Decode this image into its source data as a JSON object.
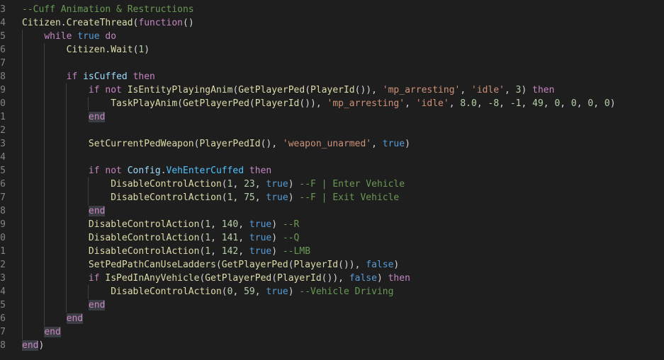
{
  "editor": {
    "language": "lua",
    "lines": [
      {
        "no": "3",
        "segs": [
          {
            "t": "--Cuff Animation & Restructions",
            "c": "c"
          }
        ]
      },
      {
        "no": "4",
        "segs": [
          {
            "t": "Citizen",
            "c": "fn"
          },
          {
            "t": ".",
            "c": "pl"
          },
          {
            "t": "CreateThread",
            "c": "fn"
          },
          {
            "t": "(",
            "c": "pl"
          },
          {
            "t": "function",
            "c": "kw"
          },
          {
            "t": "()",
            "c": "pl"
          }
        ]
      },
      {
        "no": "5",
        "segs": [
          {
            "t": "    ",
            "c": "pl"
          },
          {
            "t": "while",
            "c": "kw"
          },
          {
            "t": " ",
            "c": "pl"
          },
          {
            "t": "true",
            "c": "bl"
          },
          {
            "t": " ",
            "c": "pl"
          },
          {
            "t": "do",
            "c": "kw"
          }
        ]
      },
      {
        "no": "6",
        "segs": [
          {
            "t": "        ",
            "c": "pl"
          },
          {
            "t": "Citizen",
            "c": "fn"
          },
          {
            "t": ".",
            "c": "pl"
          },
          {
            "t": "Wait",
            "c": "fn"
          },
          {
            "t": "(",
            "c": "pl"
          },
          {
            "t": "1",
            "c": "nu"
          },
          {
            "t": ")",
            "c": "pl"
          }
        ]
      },
      {
        "no": "7",
        "segs": []
      },
      {
        "no": "8",
        "segs": [
          {
            "t": "        ",
            "c": "pl"
          },
          {
            "t": "if",
            "c": "kw"
          },
          {
            "t": " ",
            "c": "pl"
          },
          {
            "t": "isCuffed",
            "c": "vr"
          },
          {
            "t": " ",
            "c": "pl"
          },
          {
            "t": "then",
            "c": "kw"
          }
        ]
      },
      {
        "no": "9",
        "segs": [
          {
            "t": "            ",
            "c": "pl"
          },
          {
            "t": "if",
            "c": "kw"
          },
          {
            "t": " ",
            "c": "pl"
          },
          {
            "t": "not",
            "c": "kw"
          },
          {
            "t": " ",
            "c": "pl"
          },
          {
            "t": "IsEntityPlayingAnim",
            "c": "fn"
          },
          {
            "t": "(",
            "c": "pl"
          },
          {
            "t": "GetPlayerPed",
            "c": "fn"
          },
          {
            "t": "(",
            "c": "pl"
          },
          {
            "t": "PlayerId",
            "c": "fn"
          },
          {
            "t": "()), ",
            "c": "pl"
          },
          {
            "t": "'mp_arresting'",
            "c": "st"
          },
          {
            "t": ", ",
            "c": "pl"
          },
          {
            "t": "'idle'",
            "c": "st"
          },
          {
            "t": ", ",
            "c": "pl"
          },
          {
            "t": "3",
            "c": "nu"
          },
          {
            "t": ") ",
            "c": "pl"
          },
          {
            "t": "then",
            "c": "kw"
          }
        ]
      },
      {
        "no": "0",
        "segs": [
          {
            "t": "                ",
            "c": "pl"
          },
          {
            "t": "TaskPlayAnim",
            "c": "fn"
          },
          {
            "t": "(",
            "c": "pl"
          },
          {
            "t": "GetPlayerPed",
            "c": "fn"
          },
          {
            "t": "(",
            "c": "pl"
          },
          {
            "t": "PlayerId",
            "c": "fn"
          },
          {
            "t": "()), ",
            "c": "pl"
          },
          {
            "t": "'mp_arresting'",
            "c": "st"
          },
          {
            "t": ", ",
            "c": "pl"
          },
          {
            "t": "'idle'",
            "c": "st"
          },
          {
            "t": ", ",
            "c": "pl"
          },
          {
            "t": "8.0",
            "c": "nu"
          },
          {
            "t": ", ",
            "c": "pl"
          },
          {
            "t": "-8",
            "c": "nu"
          },
          {
            "t": ", ",
            "c": "pl"
          },
          {
            "t": "-1",
            "c": "nu"
          },
          {
            "t": ", ",
            "c": "pl"
          },
          {
            "t": "49",
            "c": "nu"
          },
          {
            "t": ", ",
            "c": "pl"
          },
          {
            "t": "0",
            "c": "nu"
          },
          {
            "t": ", ",
            "c": "pl"
          },
          {
            "t": "0",
            "c": "nu"
          },
          {
            "t": ", ",
            "c": "pl"
          },
          {
            "t": "0",
            "c": "nu"
          },
          {
            "t": ", ",
            "c": "pl"
          },
          {
            "t": "0",
            "c": "nu"
          },
          {
            "t": ")",
            "c": "pl"
          }
        ]
      },
      {
        "no": "1",
        "segs": [
          {
            "t": "            ",
            "c": "pl"
          },
          {
            "t": "end",
            "c": "kw",
            "blk": true
          }
        ]
      },
      {
        "no": "2",
        "segs": []
      },
      {
        "no": "3",
        "segs": [
          {
            "t": "            ",
            "c": "pl"
          },
          {
            "t": "SetCurrentPedWeapon",
            "c": "fn"
          },
          {
            "t": "(",
            "c": "pl"
          },
          {
            "t": "PlayerPedId",
            "c": "fn"
          },
          {
            "t": "(), ",
            "c": "pl"
          },
          {
            "t": "'weapon_unarmed'",
            "c": "st"
          },
          {
            "t": ", ",
            "c": "pl"
          },
          {
            "t": "true",
            "c": "bl"
          },
          {
            "t": ")",
            "c": "pl"
          }
        ]
      },
      {
        "no": "4",
        "segs": []
      },
      {
        "no": "5",
        "segs": [
          {
            "t": "            ",
            "c": "pl"
          },
          {
            "t": "if",
            "c": "kw"
          },
          {
            "t": " ",
            "c": "pl"
          },
          {
            "t": "not",
            "c": "kw"
          },
          {
            "t": " ",
            "c": "pl"
          },
          {
            "t": "Config",
            "c": "vr"
          },
          {
            "t": ".",
            "c": "pl"
          },
          {
            "t": "VehEnterCuffed",
            "c": "mb"
          },
          {
            "t": " ",
            "c": "pl"
          },
          {
            "t": "then",
            "c": "kw"
          }
        ]
      },
      {
        "no": "6",
        "segs": [
          {
            "t": "                ",
            "c": "pl"
          },
          {
            "t": "DisableControlAction",
            "c": "fn"
          },
          {
            "t": "(",
            "c": "pl"
          },
          {
            "t": "1",
            "c": "nu"
          },
          {
            "t": ", ",
            "c": "pl"
          },
          {
            "t": "23",
            "c": "nu"
          },
          {
            "t": ", ",
            "c": "pl"
          },
          {
            "t": "true",
            "c": "bl"
          },
          {
            "t": ") ",
            "c": "pl"
          },
          {
            "t": "--F | Enter Vehicle",
            "c": "c"
          }
        ]
      },
      {
        "no": "7",
        "segs": [
          {
            "t": "                ",
            "c": "pl"
          },
          {
            "t": "DisableControlAction",
            "c": "fn"
          },
          {
            "t": "(",
            "c": "pl"
          },
          {
            "t": "1",
            "c": "nu"
          },
          {
            "t": ", ",
            "c": "pl"
          },
          {
            "t": "75",
            "c": "nu"
          },
          {
            "t": ", ",
            "c": "pl"
          },
          {
            "t": "true",
            "c": "bl"
          },
          {
            "t": ") ",
            "c": "pl"
          },
          {
            "t": "--F | Exit Vehicle",
            "c": "c"
          }
        ]
      },
      {
        "no": "8",
        "segs": [
          {
            "t": "            ",
            "c": "pl"
          },
          {
            "t": "end",
            "c": "kw",
            "blk": true
          }
        ]
      },
      {
        "no": "9",
        "segs": [
          {
            "t": "            ",
            "c": "pl"
          },
          {
            "t": "DisableControlAction",
            "c": "fn"
          },
          {
            "t": "(",
            "c": "pl"
          },
          {
            "t": "1",
            "c": "nu"
          },
          {
            "t": ", ",
            "c": "pl"
          },
          {
            "t": "140",
            "c": "nu"
          },
          {
            "t": ", ",
            "c": "pl"
          },
          {
            "t": "true",
            "c": "bl"
          },
          {
            "t": ") ",
            "c": "pl"
          },
          {
            "t": "--R",
            "c": "c"
          }
        ]
      },
      {
        "no": "0",
        "segs": [
          {
            "t": "            ",
            "c": "pl"
          },
          {
            "t": "DisableControlAction",
            "c": "fn"
          },
          {
            "t": "(",
            "c": "pl"
          },
          {
            "t": "1",
            "c": "nu"
          },
          {
            "t": ", ",
            "c": "pl"
          },
          {
            "t": "141",
            "c": "nu"
          },
          {
            "t": ", ",
            "c": "pl"
          },
          {
            "t": "true",
            "c": "bl"
          },
          {
            "t": ") ",
            "c": "pl"
          },
          {
            "t": "--Q",
            "c": "c"
          }
        ]
      },
      {
        "no": "1",
        "segs": [
          {
            "t": "            ",
            "c": "pl"
          },
          {
            "t": "DisableControlAction",
            "c": "fn"
          },
          {
            "t": "(",
            "c": "pl"
          },
          {
            "t": "1",
            "c": "nu"
          },
          {
            "t": ", ",
            "c": "pl"
          },
          {
            "t": "142",
            "c": "nu"
          },
          {
            "t": ", ",
            "c": "pl"
          },
          {
            "t": "true",
            "c": "bl"
          },
          {
            "t": ") ",
            "c": "pl"
          },
          {
            "t": "--LMB",
            "c": "c"
          }
        ]
      },
      {
        "no": "2",
        "segs": [
          {
            "t": "            ",
            "c": "pl"
          },
          {
            "t": "SetPedPathCanUseLadders",
            "c": "fn"
          },
          {
            "t": "(",
            "c": "pl"
          },
          {
            "t": "GetPlayerPed",
            "c": "fn"
          },
          {
            "t": "(",
            "c": "pl"
          },
          {
            "t": "PlayerId",
            "c": "fn"
          },
          {
            "t": "()), ",
            "c": "pl"
          },
          {
            "t": "false",
            "c": "bl"
          },
          {
            "t": ")",
            "c": "pl"
          }
        ]
      },
      {
        "no": "3",
        "segs": [
          {
            "t": "            ",
            "c": "pl"
          },
          {
            "t": "if",
            "c": "kw"
          },
          {
            "t": " ",
            "c": "pl"
          },
          {
            "t": "IsPedInAnyVehicle",
            "c": "fn"
          },
          {
            "t": "(",
            "c": "pl"
          },
          {
            "t": "GetPlayerPed",
            "c": "fn"
          },
          {
            "t": "(",
            "c": "pl"
          },
          {
            "t": "PlayerId",
            "c": "fn"
          },
          {
            "t": "()), ",
            "c": "pl"
          },
          {
            "t": "false",
            "c": "bl"
          },
          {
            "t": ") ",
            "c": "pl"
          },
          {
            "t": "then",
            "c": "kw"
          }
        ]
      },
      {
        "no": "4",
        "segs": [
          {
            "t": "                ",
            "c": "pl"
          },
          {
            "t": "DisableControlAction",
            "c": "fn"
          },
          {
            "t": "(",
            "c": "pl"
          },
          {
            "t": "0",
            "c": "nu"
          },
          {
            "t": ", ",
            "c": "pl"
          },
          {
            "t": "59",
            "c": "nu"
          },
          {
            "t": ", ",
            "c": "pl"
          },
          {
            "t": "true",
            "c": "bl"
          },
          {
            "t": ") ",
            "c": "pl"
          },
          {
            "t": "--Vehicle Driving",
            "c": "c"
          }
        ]
      },
      {
        "no": "5",
        "segs": [
          {
            "t": "            ",
            "c": "pl"
          },
          {
            "t": "end",
            "c": "kw",
            "blk": true
          }
        ]
      },
      {
        "no": "6",
        "segs": [
          {
            "t": "        ",
            "c": "pl"
          },
          {
            "t": "end",
            "c": "kw",
            "blk": true
          }
        ]
      },
      {
        "no": "7",
        "segs": [
          {
            "t": "    ",
            "c": "pl"
          },
          {
            "t": "end",
            "c": "kw",
            "blk": true
          }
        ]
      },
      {
        "no": "8",
        "segs": [
          {
            "t": "end",
            "c": "kw",
            "blk": true
          },
          {
            "t": ")",
            "c": "pl"
          }
        ]
      }
    ]
  }
}
